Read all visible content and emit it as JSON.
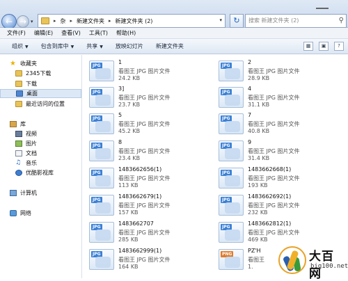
{
  "address": {
    "crumbs": [
      "杂",
      "新建文件夹",
      "新建文件夹 (2)"
    ],
    "search_placeholder": "搜索 新建文件夹 (2)"
  },
  "menu": [
    "文件(F)",
    "编辑(E)",
    "查看(V)",
    "工具(T)",
    "帮助(H)"
  ],
  "toolbar": {
    "organize": "组织",
    "include_library": "包含到库中",
    "share": "共享",
    "slideshow": "放映幻灯片",
    "new_folder": "新建文件夹"
  },
  "sidebar": {
    "favorites": "收藏夹",
    "downloads_2345": "2345下载",
    "downloads": "下载",
    "desktop": "桌面",
    "recent": "最近访问的位置",
    "libraries": "库",
    "videos": "视频",
    "pictures": "图片",
    "documents": "文档",
    "music": "音乐",
    "media_library": "优酷影视库",
    "computer": "计算机",
    "network": "网络"
  },
  "files": [
    {
      "name": "1",
      "type": "看图王 JPG 图片文件",
      "size": "24.2 KB",
      "ext": "JPG"
    },
    {
      "name": "2",
      "type": "看图王 JPG 图片文件",
      "size": "28.9 KB",
      "ext": "JPG"
    },
    {
      "name": "3]",
      "type": "看图王 JPG 图片文件",
      "size": "23.7 KB",
      "ext": "JPG"
    },
    {
      "name": "4",
      "type": "看图王 JPG 图片文件",
      "size": "31.1 KB",
      "ext": "JPG"
    },
    {
      "name": "5",
      "type": "看图王 JPG 图片文件",
      "size": "45.2 KB",
      "ext": "JPG"
    },
    {
      "name": "7",
      "type": "看图王 JPG 图片文件",
      "size": "40.8 KB",
      "ext": "JPG"
    },
    {
      "name": "8",
      "type": "看图王 JPG 图片文件",
      "size": "23.4 KB",
      "ext": "JPG"
    },
    {
      "name": "9",
      "type": "看图王 JPG 图片文件",
      "size": "31.4 KB",
      "ext": "JPG"
    },
    {
      "name": "1483662656(1)",
      "type": "看图王 JPG 图片文件",
      "size": "113 KB",
      "ext": "JPG"
    },
    {
      "name": "1483662668(1)",
      "type": "看图王 JPG 图片文件",
      "size": "193 KB",
      "ext": "JPG"
    },
    {
      "name": "1483662679(1)",
      "type": "看图王 JPG 图片文件",
      "size": "157 KB",
      "ext": "JPG"
    },
    {
      "name": "1483662692(1)",
      "type": "看图王 JPG 图片文件",
      "size": "232 KB",
      "ext": "JPG"
    },
    {
      "name": "1483662707",
      "type": "看图王 JPG 图片文件",
      "size": "285 KB",
      "ext": "JPG"
    },
    {
      "name": "1483662812(1)",
      "type": "看图王 JPG 图片文件",
      "size": "469 KB",
      "ext": "JPG"
    },
    {
      "name": "1483662999(1)",
      "type": "看图王 JPG 图片文件",
      "size": "164 KB",
      "ext": "JPG"
    },
    {
      "name": "PZ'H",
      "type": "看图王",
      "size": "1.",
      "ext": "PNG"
    }
  ],
  "watermark": {
    "title": "大百网",
    "sub": "big100.net"
  }
}
